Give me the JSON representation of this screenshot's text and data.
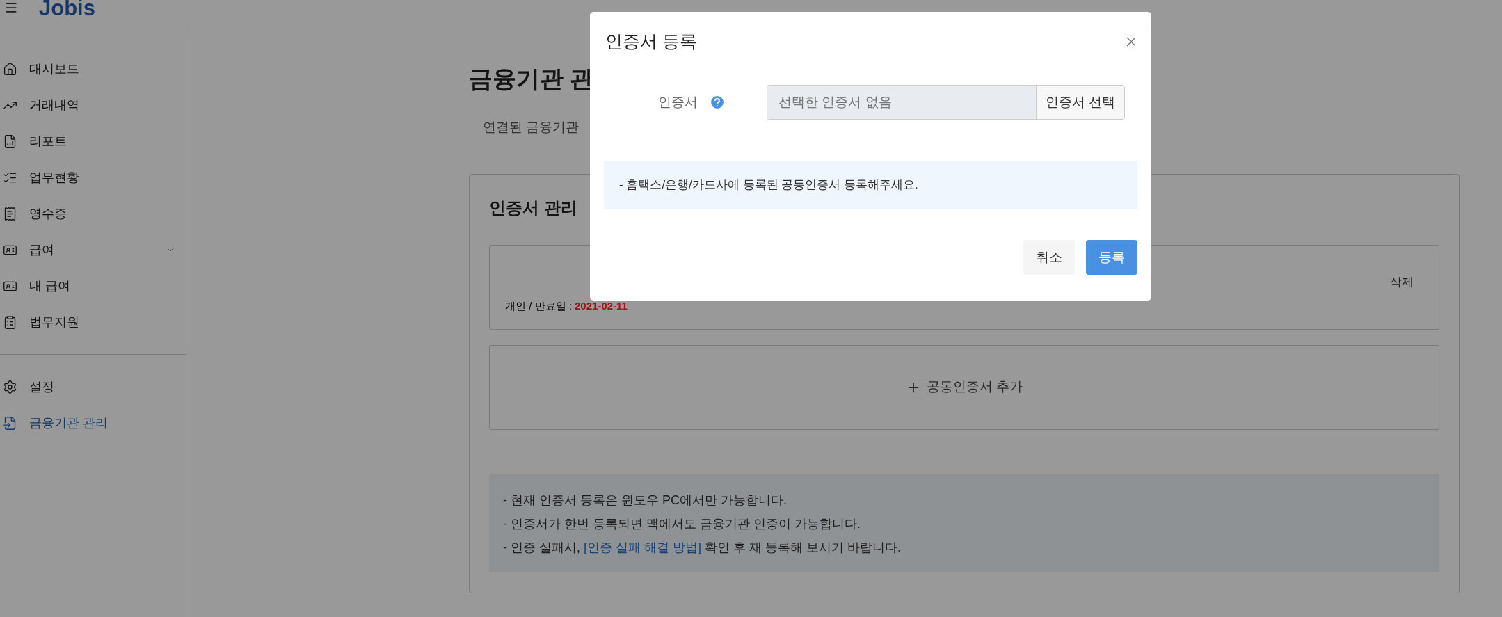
{
  "header": {
    "logo": "Jobis"
  },
  "sidebar": {
    "items": [
      {
        "label": "대시보드",
        "selected": false,
        "kind": "link"
      },
      {
        "label": "거래내역",
        "selected": false,
        "kind": "link"
      },
      {
        "label": "리포트",
        "selected": false,
        "kind": "link"
      },
      {
        "label": "업무현황",
        "selected": false,
        "kind": "link"
      },
      {
        "label": "영수증",
        "selected": false,
        "kind": "link"
      },
      {
        "label": "급여",
        "selected": false,
        "kind": "group"
      },
      {
        "label": "내 급여",
        "selected": false,
        "kind": "link"
      },
      {
        "label": "법무지원",
        "selected": false,
        "kind": "link"
      }
    ],
    "bottom_items": [
      {
        "label": "설정",
        "selected": false
      },
      {
        "label": "금융기관 관리",
        "selected": true
      }
    ]
  },
  "page": {
    "title": "금융기관 관",
    "tab": "연결된 금융기관",
    "card": {
      "title": "인증서 관리",
      "certificate": {
        "type": "개인 / 만료일 : ",
        "expiry": "2021-02-11",
        "delete": "삭제"
      },
      "add_button": "공동인증서 추가",
      "notes": [
        "- 현재 인증서 등록은 윈도우 PC에서만 가능합니다.",
        "- 인증서가 한번 등록되면 맥에서도 금융기관 인증이 가능합니다.",
        "- 인증 실패시, "
      ],
      "note_link": "[인증 실패 해결 방법]",
      "note_tail": " 확인 후 재 등록해 보시기 바랍니다."
    }
  },
  "modal": {
    "title": "인증서 등록",
    "field_label": "인증서",
    "placeholder": "선택한 인증서 없음",
    "select_button": "인증서 선택",
    "info": "- 홈택스/은행/카드사에 등록된 공동인증서 등록해주세요.",
    "buttons": [
      "취소",
      "등록"
    ]
  }
}
